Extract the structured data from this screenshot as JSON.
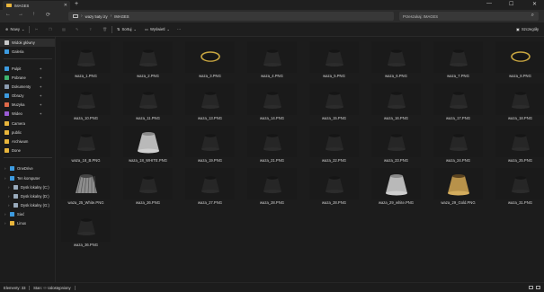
{
  "window": {
    "tab_title": "IMAGES",
    "close_tab": "✕",
    "new_tab": "+",
    "minimize": "—",
    "maximize": "☐",
    "close": "✕"
  },
  "address": {
    "breadcrumb": [
      "wazy 5aty izy",
      "IMAGES"
    ],
    "separator": "›",
    "search_placeholder": "Przeszukaj: IMAGES"
  },
  "toolbar": {
    "new_label": "Nowy",
    "sort_label": "Sortuj",
    "view_label": "Wyświetl",
    "more_label": "···",
    "details_label": "Szczegóły"
  },
  "sidebar": {
    "items": [
      {
        "label": "Widok główny",
        "icon": "home-icon",
        "color": "#c9c9c9",
        "active": true
      },
      {
        "label": "Galeria",
        "icon": "gallery-icon",
        "color": "#3d9be0",
        "active": false
      },
      {
        "label": "Pulpit",
        "icon": "desktop-icon",
        "color": "#3d9be0",
        "pinned": true
      },
      {
        "label": "Pobrane",
        "icon": "download-icon",
        "color": "#3fb56f",
        "pinned": true
      },
      {
        "label": "Dokumenty",
        "icon": "documents-icon",
        "color": "#8a9bb0",
        "pinned": true
      },
      {
        "label": "Obrazy",
        "icon": "pictures-icon",
        "color": "#3d9be0",
        "pinned": true
      },
      {
        "label": "Muzyka",
        "icon": "music-icon",
        "color": "#e06a4a",
        "pinned": true
      },
      {
        "label": "Wideo",
        "icon": "video-icon",
        "color": "#9a5cd6",
        "pinned": true
      },
      {
        "label": "Camera",
        "icon": "folder-icon",
        "color": "#e8b53c",
        "pinned": false
      },
      {
        "label": "public",
        "icon": "folder-icon",
        "color": "#e8b53c",
        "pinned": false
      },
      {
        "label": "Archiwum",
        "icon": "folder-icon",
        "color": "#e8b53c",
        "pinned": false
      },
      {
        "label": "Done",
        "icon": "folder-icon",
        "color": "#e8b53c",
        "pinned": false
      },
      {
        "label": "OneDrive",
        "icon": "cloud-icon",
        "color": "#3d9be0",
        "expandable": true
      },
      {
        "label": "Ten komputer",
        "icon": "computer-icon",
        "color": "#3d9be0",
        "expandable": true
      },
      {
        "label": "Dysk lokalny (C:)",
        "icon": "drive-icon",
        "color": "#9ab",
        "expandable": true
      },
      {
        "label": "Dysk lokalny (D:)",
        "icon": "drive-icon",
        "color": "#9ab",
        "expandable": true
      },
      {
        "label": "Dysk lokalny (G:)",
        "icon": "drive-icon",
        "color": "#9ab",
        "expandable": true
      },
      {
        "label": "Sieć",
        "icon": "network-icon",
        "color": "#3d9be0",
        "expandable": true
      },
      {
        "label": "Linux",
        "icon": "linux-icon",
        "color": "#e8b53c",
        "expandable": true
      }
    ]
  },
  "files": [
    {
      "name": "waza_1.PNG",
      "kind": "dark"
    },
    {
      "name": "waza_2.PNG",
      "kind": "dark"
    },
    {
      "name": "waza_3.PNG",
      "kind": "goldring"
    },
    {
      "name": "waza_4.PNG",
      "kind": "dark"
    },
    {
      "name": "waza_5.PNG",
      "kind": "dark"
    },
    {
      "name": "waza_6.PNG",
      "kind": "dark"
    },
    {
      "name": "waza_7.PNG",
      "kind": "dark"
    },
    {
      "name": "waza_8.PNG",
      "kind": "goldring"
    },
    {
      "name": "waza_10.PNG",
      "kind": "dark"
    },
    {
      "name": "waza_11.PNG",
      "kind": "dark"
    },
    {
      "name": "waza_13.PNG",
      "kind": "dark"
    },
    {
      "name": "waza_14.PNG",
      "kind": "dark"
    },
    {
      "name": "waza_15.PNG",
      "kind": "dark"
    },
    {
      "name": "waza_16.PNG",
      "kind": "dark"
    },
    {
      "name": "waza_17.PNG",
      "kind": "dark"
    },
    {
      "name": "waza_18.PNG",
      "kind": "dark"
    },
    {
      "name": "waza_18_B.PNG",
      "kind": "dark"
    },
    {
      "name": "waza_18_WHITE.PNG",
      "kind": "white"
    },
    {
      "name": "waza_19.PNG",
      "kind": "dark"
    },
    {
      "name": "waza_21.PNG",
      "kind": "dark"
    },
    {
      "name": "waza_22.PNG",
      "kind": "dark"
    },
    {
      "name": "waza_23.PNG",
      "kind": "dark"
    },
    {
      "name": "waza_24.PNG",
      "kind": "dark"
    },
    {
      "name": "waza_25.PNG",
      "kind": "dark"
    },
    {
      "name": "waza_25_White.PNG",
      "kind": "lattice"
    },
    {
      "name": "waza_26.PNG",
      "kind": "dark"
    },
    {
      "name": "waza_27.PNG",
      "kind": "dark"
    },
    {
      "name": "waza_28.PNG",
      "kind": "dark"
    },
    {
      "name": "waza_28.PNG",
      "kind": "dark"
    },
    {
      "name": "waza_29_white.PNG",
      "kind": "white"
    },
    {
      "name": "waza_29_Gold.PNG",
      "kind": "gold"
    },
    {
      "name": "waza_31.PNG",
      "kind": "dark"
    },
    {
      "name": "waza_36.PNG",
      "kind": "dark"
    }
  ],
  "status": {
    "count": "Elementy: 33",
    "state": "Stan: ⚇ Udostępniony"
  }
}
